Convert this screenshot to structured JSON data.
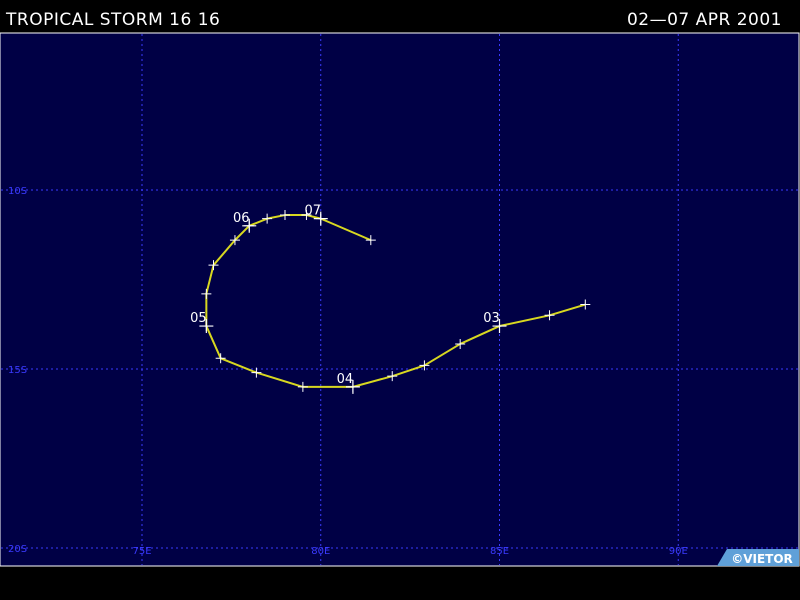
{
  "header": {
    "storm_name": "TROPICAL STORM 16 16",
    "date_range": "02—07 APR 2001"
  },
  "map": {
    "colors": {
      "background": "#000045",
      "grid": "#3a3aff",
      "border": "#ffffff",
      "track": "#d8d820",
      "label": "#ffffff"
    },
    "lat_labels": [
      "10S",
      "15S",
      "20S"
    ],
    "lon_labels": [
      "75E",
      "80E",
      "85E",
      "90E"
    ],
    "lat_values": [
      -10,
      -15,
      -20
    ],
    "lon_values": [
      75,
      80,
      85,
      90
    ],
    "copyright": "©VIETOR"
  },
  "track": {
    "points": [
      {
        "lon": 87.4,
        "lat": -13.2
      },
      {
        "lon": 86.4,
        "lat": -13.5
      },
      {
        "lon": 85.0,
        "lat": -13.8
      },
      {
        "lon": 83.9,
        "lat": -14.3
      },
      {
        "lon": 82.9,
        "lat": -14.9
      },
      {
        "lon": 82.0,
        "lat": -15.2
      },
      {
        "lon": 80.9,
        "lat": -15.5
      },
      {
        "lon": 79.5,
        "lat": -15.5
      },
      {
        "lon": 78.2,
        "lat": -15.1
      },
      {
        "lon": 77.2,
        "lat": -14.7
      },
      {
        "lon": 76.8,
        "lat": -13.8
      },
      {
        "lon": 76.8,
        "lat": -12.9
      },
      {
        "lon": 77.0,
        "lat": -12.1
      },
      {
        "lon": 77.6,
        "lat": -11.4
      },
      {
        "lon": 78.0,
        "lat": -11.0
      },
      {
        "lon": 78.5,
        "lat": -10.8
      },
      {
        "lon": 79.0,
        "lat": -10.7
      },
      {
        "lon": 79.6,
        "lat": -10.7
      },
      {
        "lon": 80.0,
        "lat": -10.8
      },
      {
        "lon": 81.4,
        "lat": -11.4
      }
    ],
    "day_labels": [
      {
        "text": "03",
        "lon": 85.0,
        "lat": -13.8
      },
      {
        "text": "04",
        "lon": 80.9,
        "lat": -15.5
      },
      {
        "text": "05",
        "lon": 76.8,
        "lat": -13.8
      },
      {
        "text": "06",
        "lon": 78.0,
        "lat": -11.0
      },
      {
        "text": "07",
        "lon": 80.0,
        "lat": -10.8
      }
    ]
  }
}
